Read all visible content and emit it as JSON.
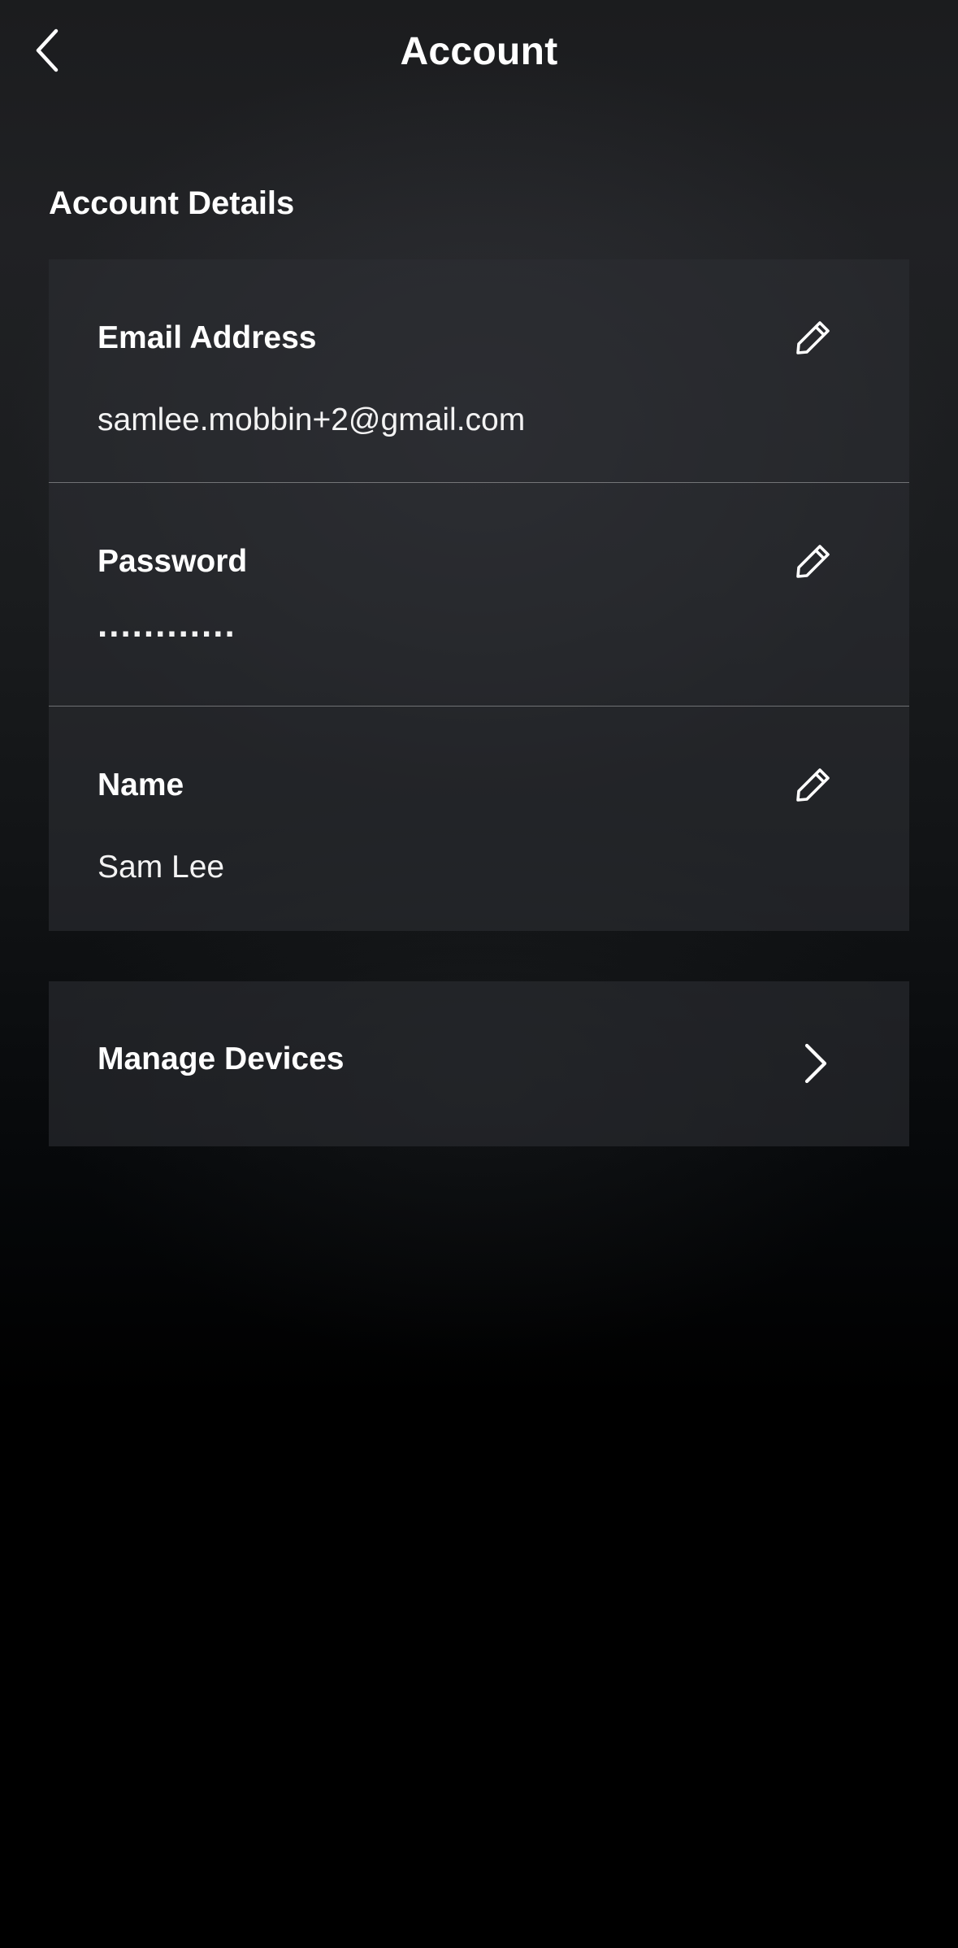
{
  "header": {
    "title": "Account",
    "back_icon": "chevron-left-icon"
  },
  "account_details": {
    "section_title": "Account Details",
    "rows": [
      {
        "label": "Email Address",
        "value": "samlee.mobbin+2@gmail.com",
        "icon": "pencil-icon"
      },
      {
        "label": "Password",
        "value": "............",
        "icon": "pencil-icon"
      },
      {
        "label": "Name",
        "value": "Sam Lee",
        "icon": "pencil-icon"
      }
    ]
  },
  "manage_devices": {
    "label": "Manage Devices",
    "icon": "chevron-right-icon"
  },
  "colors": {
    "background_top": "#202124",
    "background_bottom": "#000000",
    "card": "#2c2d32",
    "text": "#ffffff",
    "divider": "#5a5b5e"
  }
}
